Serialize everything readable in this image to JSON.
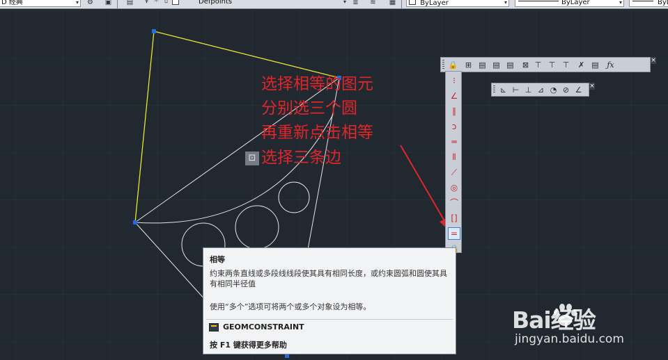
{
  "topbar": {
    "workspace_value": "D 经典",
    "layer_value": "Defpoints",
    "color_value": "ByLayer",
    "linetype_value": "ByLayer",
    "lineweight_value": "ByLayer"
  },
  "annotation": {
    "line1": "选择相等的图元",
    "line2": "分别选三个圆",
    "line3": "再重新点击相等",
    "line4": "选择三条边"
  },
  "tooltip": {
    "title": "相等",
    "description": "约束两条直线或多段线线段使其具有相同长度，或约束圆弧和圆使其具有相同半径值",
    "tip": "使用“多个”选项可将两个或多个对象设为相等。",
    "command": "GEOMCONSTRAINT",
    "help": "按 F1 键获得更多帮助"
  },
  "watermark": {
    "logo_text": "Bai经验",
    "url": "jingyan.baidu.com"
  },
  "colors": {
    "background": "#212830",
    "annotation_red": "#e0262b",
    "selected_yellow": "#e6e62a",
    "grip_blue": "#1e6fe0"
  }
}
